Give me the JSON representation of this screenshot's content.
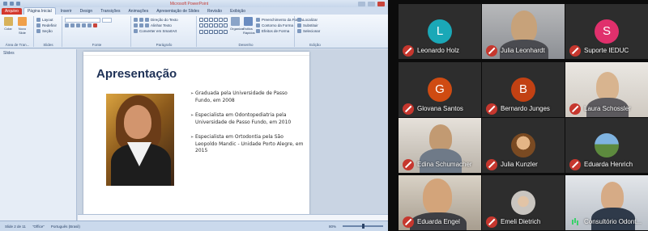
{
  "ppt": {
    "window_title": "Microsoft PowerPoint",
    "tabs": [
      "Arquivo",
      "Página Inicial",
      "Inserir",
      "Design",
      "Transições",
      "Animações",
      "Apresentação de Slides",
      "Revisão",
      "Exibição"
    ],
    "ribbon": {
      "clipboard": {
        "paste": "Colar",
        "label": "Área de Tran..."
      },
      "slides": {
        "new_slide": "Novo Slide",
        "layout": "Layout",
        "reset": "Redefinir",
        "section": "Seção",
        "label": "Slides"
      },
      "font": {
        "label": "Fonte"
      },
      "paragraph": {
        "text_direction": "Direção do Texto",
        "align_text": "Alinhar Texto",
        "smartart": "Converter em SmartArt",
        "label": "Parágrafo"
      },
      "drawing": {
        "arrange": "Organizar",
        "quick_styles": "Estilos Rápidos",
        "shape_fill": "Preenchimento da Forma",
        "shape_outline": "Contorno da Forma",
        "shape_effects": "Efeitos de Forma",
        "label": "Desenho"
      },
      "editing": {
        "find": "Localizar",
        "replace": "Substituir",
        "select": "Selecionar",
        "label": "Edição"
      }
    },
    "panel_tab": "Slides",
    "slide": {
      "title": "Apresentação",
      "bullets": [
        "Graduada pela Universidade de Passo Fundo, em 2008",
        "Especialista em Odontopediatria pela Universidade de Passo Fundo, em 2010",
        "Especialista em Ortodontia pela São Leopoldo Mandic - Unidade Porto Alegre, em 2015"
      ]
    },
    "status": {
      "slide": "Slide 2 de 11",
      "theme": "\"Office\"",
      "language": "Português (Brasil)",
      "zoom": "80%"
    }
  },
  "meeting": {
    "participants": [
      {
        "name": "Leonardo Holz",
        "initial": "L",
        "color": "#1aa8b7",
        "type": "avatar"
      },
      {
        "name": "Julia Leonhardt",
        "type": "video"
      },
      {
        "name": "Suporte IEDUC",
        "initial": "S",
        "color": "#e0306c",
        "type": "avatar"
      },
      {
        "name": "Glovana Santos",
        "initial": "G",
        "color": "#cf4b12",
        "type": "avatar"
      },
      {
        "name": "Bernardo Junges",
        "initial": "B",
        "color": "#c24113",
        "type": "avatar"
      },
      {
        "name": "Laura Schossler",
        "type": "video"
      },
      {
        "name": "Edina Schumacher",
        "type": "video"
      },
      {
        "name": "Julia Kunzler",
        "type": "thumb"
      },
      {
        "name": "Eduarda Henrich",
        "type": "thumb"
      },
      {
        "name": "Eduarda Engel",
        "type": "video"
      },
      {
        "name": "Emeli Dietrich",
        "type": "thumb"
      },
      {
        "name": "Consultório Odont...",
        "type": "video",
        "speaking": true
      }
    ]
  }
}
